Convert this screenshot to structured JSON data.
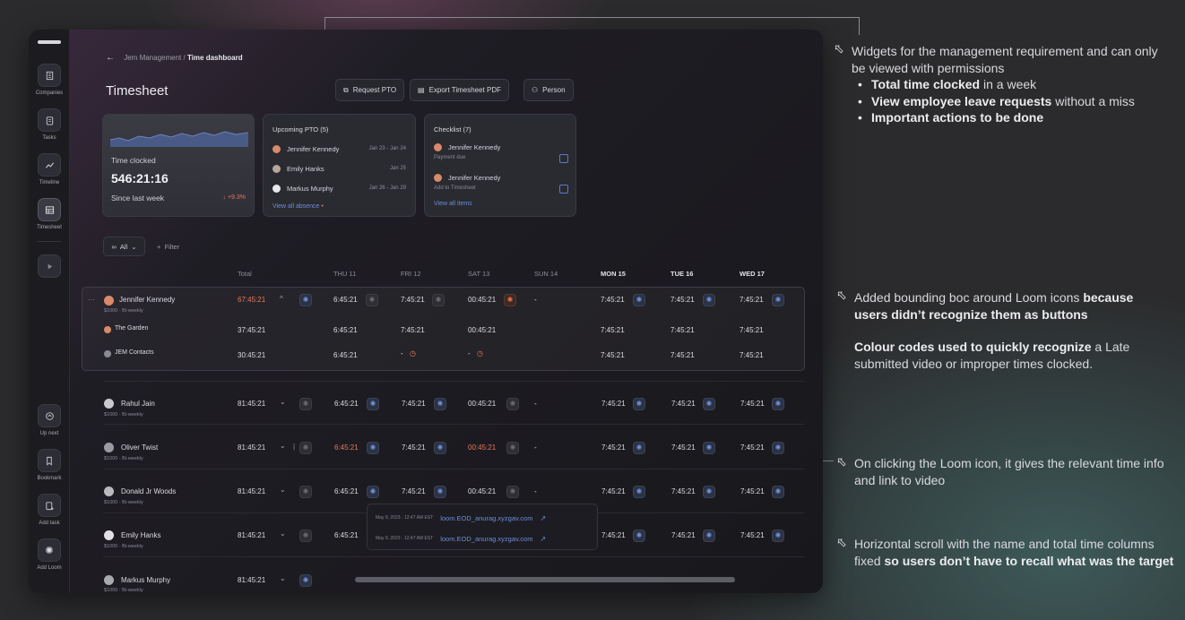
{
  "sidebar": {
    "items": [
      {
        "label": "Companies",
        "icon": "building-icon"
      },
      {
        "label": "Tasks",
        "icon": "clipboard-icon"
      },
      {
        "label": "Timeline",
        "icon": "trend-icon"
      },
      {
        "label": "Timesheet",
        "icon": "table-icon",
        "active": true
      },
      {
        "label": "",
        "icon": "play-icon"
      },
      {
        "label": "Up next",
        "icon": "up-next-icon"
      },
      {
        "label": "Bookmark",
        "icon": "bookmark-icon"
      },
      {
        "label": "Add task",
        "icon": "add-task-icon"
      },
      {
        "label": "Add Loom",
        "icon": "loom-icon"
      }
    ]
  },
  "breadcrumb": {
    "parent": "Jem Management",
    "separator": "/",
    "current": "Time dashboard"
  },
  "page_title": "Timesheet",
  "toolbar": {
    "request_pto": "Request PTO",
    "export_pdf": "Export Timesheet PDF",
    "person": "Person"
  },
  "time_card": {
    "label": "Time clocked",
    "value": "546:21:16",
    "since": "Since last week",
    "delta": "+9.3%"
  },
  "pto_card": {
    "title": "Upcoming PTO (5)",
    "rows": [
      {
        "name": "Jennifer Kennedy",
        "dates": "Jan 23 - Jan 24"
      },
      {
        "name": "Emily Hanks",
        "dates": "Jan 25"
      },
      {
        "name": "Markus Murphy",
        "dates": "Jan 26 - Jan 29"
      }
    ],
    "link": "View all absence"
  },
  "checklist_card": {
    "title": "Checklist (7)",
    "rows": [
      {
        "name": "Jennifer Kennedy",
        "task": "Payment due"
      },
      {
        "name": "Jennifer Kennedy",
        "task": "Add to Timesheet"
      }
    ],
    "link": "View all items"
  },
  "filter": {
    "all_label": "All",
    "add_filter": "Filter"
  },
  "columns": [
    "Total",
    "THU 11",
    "FRI 12",
    "SAT 13",
    "SUN 14",
    "MON 15",
    "TUE 16",
    "WED 17"
  ],
  "rows": [
    {
      "name": "Jennifer Kennedy",
      "rate": "$1000 · Bi-weekly",
      "total": "67:45:21",
      "thu": "6:45:21",
      "fri": "7:45:21",
      "sat": "00:45:21",
      "sun": "-",
      "mon": "7:45:21",
      "tue": "7:45:21",
      "wed": "7:45:21"
    },
    {
      "name": "The Garden",
      "total": "37:45:21",
      "thu": "6:45:21",
      "fri": "7:45:21",
      "sat": "00:45:21",
      "mon": "7:45:21",
      "tue": "7:45:21",
      "wed": "7:45:21"
    },
    {
      "name": "JEM Contacts",
      "total": "30:45:21",
      "thu": "6:45:21",
      "fri": "-",
      "sat": "-",
      "mon": "7:45:21",
      "tue": "7:45:21",
      "wed": "7:45:21"
    },
    {
      "name": "Rahul Jain",
      "rate": "$1000 · Bi-weekly",
      "total": "81:45:21",
      "thu": "6:45:21",
      "fri": "7:45:21",
      "sat": "00:45:21",
      "sun": "-",
      "mon": "7:45:21",
      "tue": "7:45:21",
      "wed": "7:45:21"
    },
    {
      "name": "Oliver Twist",
      "rate": "$1000 · Bi-weekly",
      "total": "81:45:21",
      "thu": "6:45:21",
      "fri": "7:45:21",
      "sat": "00:45:21",
      "sun": "-",
      "mon": "7:45:21",
      "tue": "7:45:21",
      "wed": "7:45:21"
    },
    {
      "name": "Donald Jr Woods",
      "rate": "$1000 · Bi-weekly",
      "total": "81:45:21",
      "thu": "6:45:21",
      "fri": "7:45:21",
      "sat": "00:45:21",
      "sun": "-",
      "mon": "7:45:21",
      "tue": "7:45:21",
      "wed": "7:45:21"
    },
    {
      "name": "Emily Hanks",
      "rate": "$1000 · Bi-weekly",
      "total": "81:45:21",
      "thu": "6:45:21",
      "mon": "7:45:21",
      "tue": "7:45:21",
      "wed": "7:45:21"
    },
    {
      "name": "Markus Murphy",
      "rate": "$1000 · Bi-weekly",
      "total": "81:45:21"
    }
  ],
  "loom_popup": [
    {
      "date": "May 9, 2023 · 12:47 AM EST",
      "url": "loom.EOD_anurag.xyzgav.com"
    },
    {
      "date": "May 9, 2023 · 12:47 AM EST",
      "url": "loom.EOD_anurag.xyzgav.com"
    }
  ],
  "notes": {
    "n1": {
      "text": "Widgets for the management requirement and can only be viewed with permissions",
      "b1": "Total time clocked",
      "b1_rest": " in a week",
      "b2": "View employee leave requests",
      "b2_rest": " without a miss",
      "b3": "Important actions to be done"
    },
    "n2": {
      "t1": "Added bounding boc around Loom icons ",
      "b1": "because users didn’t recognize them as buttons",
      "b2": "Colour codes used to quickly recognize",
      "t2": " a Late submitted video or improper times clocked."
    },
    "n3": {
      "text": "On clicking the Loom icon, it gives the relevant time info and link to video"
    },
    "n4": {
      "t1": "Horizontal scroll with the name and total time columns fixed ",
      "b1": "so users don’t have to recall what was the target"
    }
  },
  "colors": {
    "late": "#e6795a",
    "link": "#6f8ed8",
    "loom": "#6f8fe0",
    "accent_orange": "#f06a3a"
  }
}
